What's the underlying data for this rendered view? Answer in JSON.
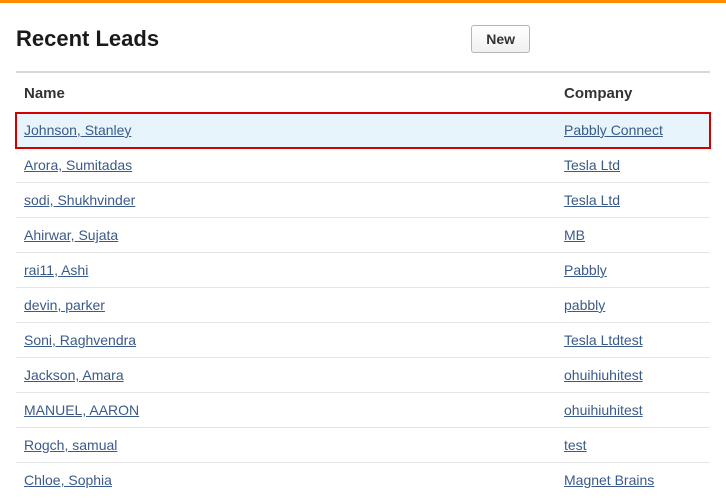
{
  "header": {
    "title": "Recent Leads",
    "new_button": "New"
  },
  "table": {
    "columns": {
      "name": "Name",
      "company": "Company"
    },
    "rows": [
      {
        "name": "Johnson, Stanley",
        "company": "Pabbly Connect",
        "highlighted": true
      },
      {
        "name": "Arora, Sumitadas",
        "company": "Tesla Ltd"
      },
      {
        "name": "sodi, Shukhvinder",
        "company": "Tesla Ltd"
      },
      {
        "name": "Ahirwar, Sujata",
        "company": "MB"
      },
      {
        "name": "rai11, Ashi",
        "company": "Pabbly"
      },
      {
        "name": "devin, parker",
        "company": "pabbly"
      },
      {
        "name": "Soni, Raghvendra",
        "company": "Tesla Ltdtest"
      },
      {
        "name": "Jackson, Amara",
        "company": "ohuihiuhitest"
      },
      {
        "name": "MANUEL, AARON",
        "company": "ohuihiuhitest"
      },
      {
        "name": "Rogch, samual",
        "company": "test"
      },
      {
        "name": "Chloe, Sophia",
        "company": "Magnet Brains"
      }
    ]
  }
}
